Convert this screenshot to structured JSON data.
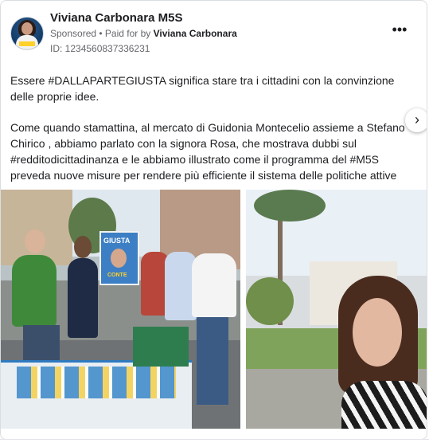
{
  "post": {
    "author": "Viviana Carbonara M5S",
    "sponsored_label": "Sponsored",
    "separator": " • ",
    "paid_for_prefix": "Paid for by ",
    "payer": "Viviana Carbonara",
    "ad_id": "ID: 1234560837336231",
    "more_icon": "more-options-icon",
    "text_paragraph_1": "Essere #DALLAPARTEGIUSTA significa stare tra i cittadini con la convinzione delle proprie idee.",
    "text_paragraph_2": "Come quando stamattina, al mercato di Guidonia Montecelio assieme a Stefano Chirico , abbiamo parlato con la signora Rosa, che mostrava dubbi sul #redditodicittadinanza e le abbiamo illustrato come il programma del #M5S preveda nuove misure per rendere più efficiente il sistema delle politiche attive de…"
  },
  "media": {
    "images": [
      {
        "name": "campaign-stand-photo",
        "sign_text": "GIUSTA",
        "sign_name": "CONTE"
      },
      {
        "name": "selfie-photo"
      }
    ],
    "next_icon": "chevron-right-icon"
  },
  "colors": {
    "text": "#1c1e21",
    "secondary": "#65676b",
    "border": "#dadde1"
  }
}
